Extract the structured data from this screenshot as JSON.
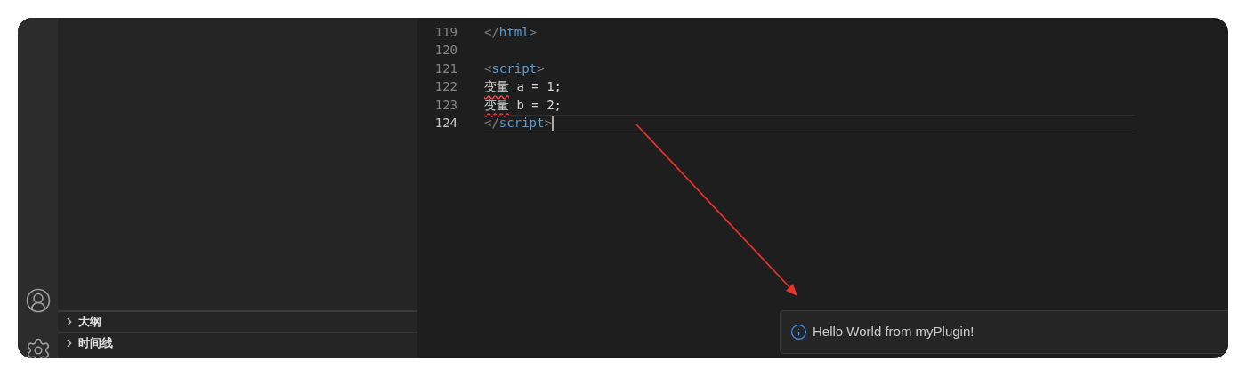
{
  "sidebar": {
    "sections": [
      {
        "title": "大纲",
        "expanded": false
      },
      {
        "title": "时间线",
        "expanded": false
      }
    ]
  },
  "editor": {
    "lines": [
      {
        "number": "119",
        "current": false,
        "tokens": [
          {
            "kind": "punct",
            "text": "</"
          },
          {
            "kind": "tag",
            "text": "html"
          },
          {
            "kind": "punct",
            "text": ">"
          }
        ]
      },
      {
        "number": "120",
        "current": false
      },
      {
        "number": "121",
        "current": false,
        "tokens": [
          {
            "kind": "punct",
            "text": "<"
          },
          {
            "kind": "tag",
            "text": "script"
          },
          {
            "kind": "punct",
            "text": ">"
          }
        ]
      },
      {
        "number": "122",
        "current": false,
        "tokens": [
          {
            "kind": "error",
            "text": "变量"
          },
          {
            "kind": "text",
            "text": " a = 1;"
          }
        ]
      },
      {
        "number": "123",
        "current": false,
        "tokens": [
          {
            "kind": "error",
            "text": "变量"
          },
          {
            "kind": "text",
            "text": " b = 2;"
          }
        ]
      },
      {
        "number": "124",
        "current": true,
        "tokens": [
          {
            "kind": "punct",
            "text": "</"
          },
          {
            "kind": "tag",
            "text": "script"
          },
          {
            "kind": "punct",
            "text": ">"
          }
        ]
      }
    ]
  },
  "notification": {
    "message": "Hello World from myPlugin!"
  }
}
